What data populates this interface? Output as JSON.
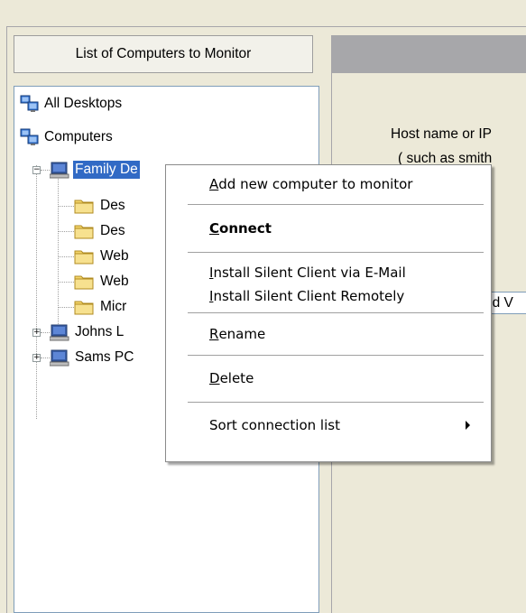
{
  "left_panel": {
    "header_button": "List of Computers to Monitor",
    "tree": [
      {
        "label": "All Desktops",
        "icon": "network-computers-icon"
      },
      {
        "label": "Computers",
        "icon": "network-computers-icon"
      },
      {
        "label": "Family Desktop",
        "label_visible": "Family De",
        "icon": "computer-icon",
        "expander": "−",
        "selected": true
      },
      {
        "label": "Des",
        "icon": "folder-icon"
      },
      {
        "label": "Des",
        "icon": "folder-icon"
      },
      {
        "label": "Web",
        "icon": "folder-icon"
      },
      {
        "label": "Web",
        "icon": "folder-icon"
      },
      {
        "label": "Micr",
        "icon": "folder-icon"
      },
      {
        "label": "Johns L",
        "icon": "computer-icon",
        "expander": "+"
      },
      {
        "label": "Sams PC",
        "icon": "computer-icon",
        "expander": "+"
      }
    ]
  },
  "right_panel": {
    "line1": "Host name or IP",
    "line2": "( such as smith",
    "field_value": "ed V"
  },
  "context_menu": {
    "items": [
      {
        "pre": "",
        "ul": "A",
        "post": "dd new computer to monitor"
      },
      {
        "pre": "",
        "ul": "C",
        "post": "onnect"
      },
      {
        "pre": "",
        "ul": "I",
        "post": "nstall Silent Client via E-Mail"
      },
      {
        "pre": "",
        "ul": "I",
        "post": "nstall Silent Client Remotely"
      },
      {
        "pre": "",
        "ul": "R",
        "post": "ename"
      },
      {
        "pre": "",
        "ul": "D",
        "post": "elete"
      },
      {
        "pre": "",
        "ul": "",
        "post": "Sort connection list"
      }
    ]
  },
  "colors": {
    "selection": "#316ac5",
    "window_bg": "#ece9d8",
    "tree_border": "#7f9db9"
  }
}
